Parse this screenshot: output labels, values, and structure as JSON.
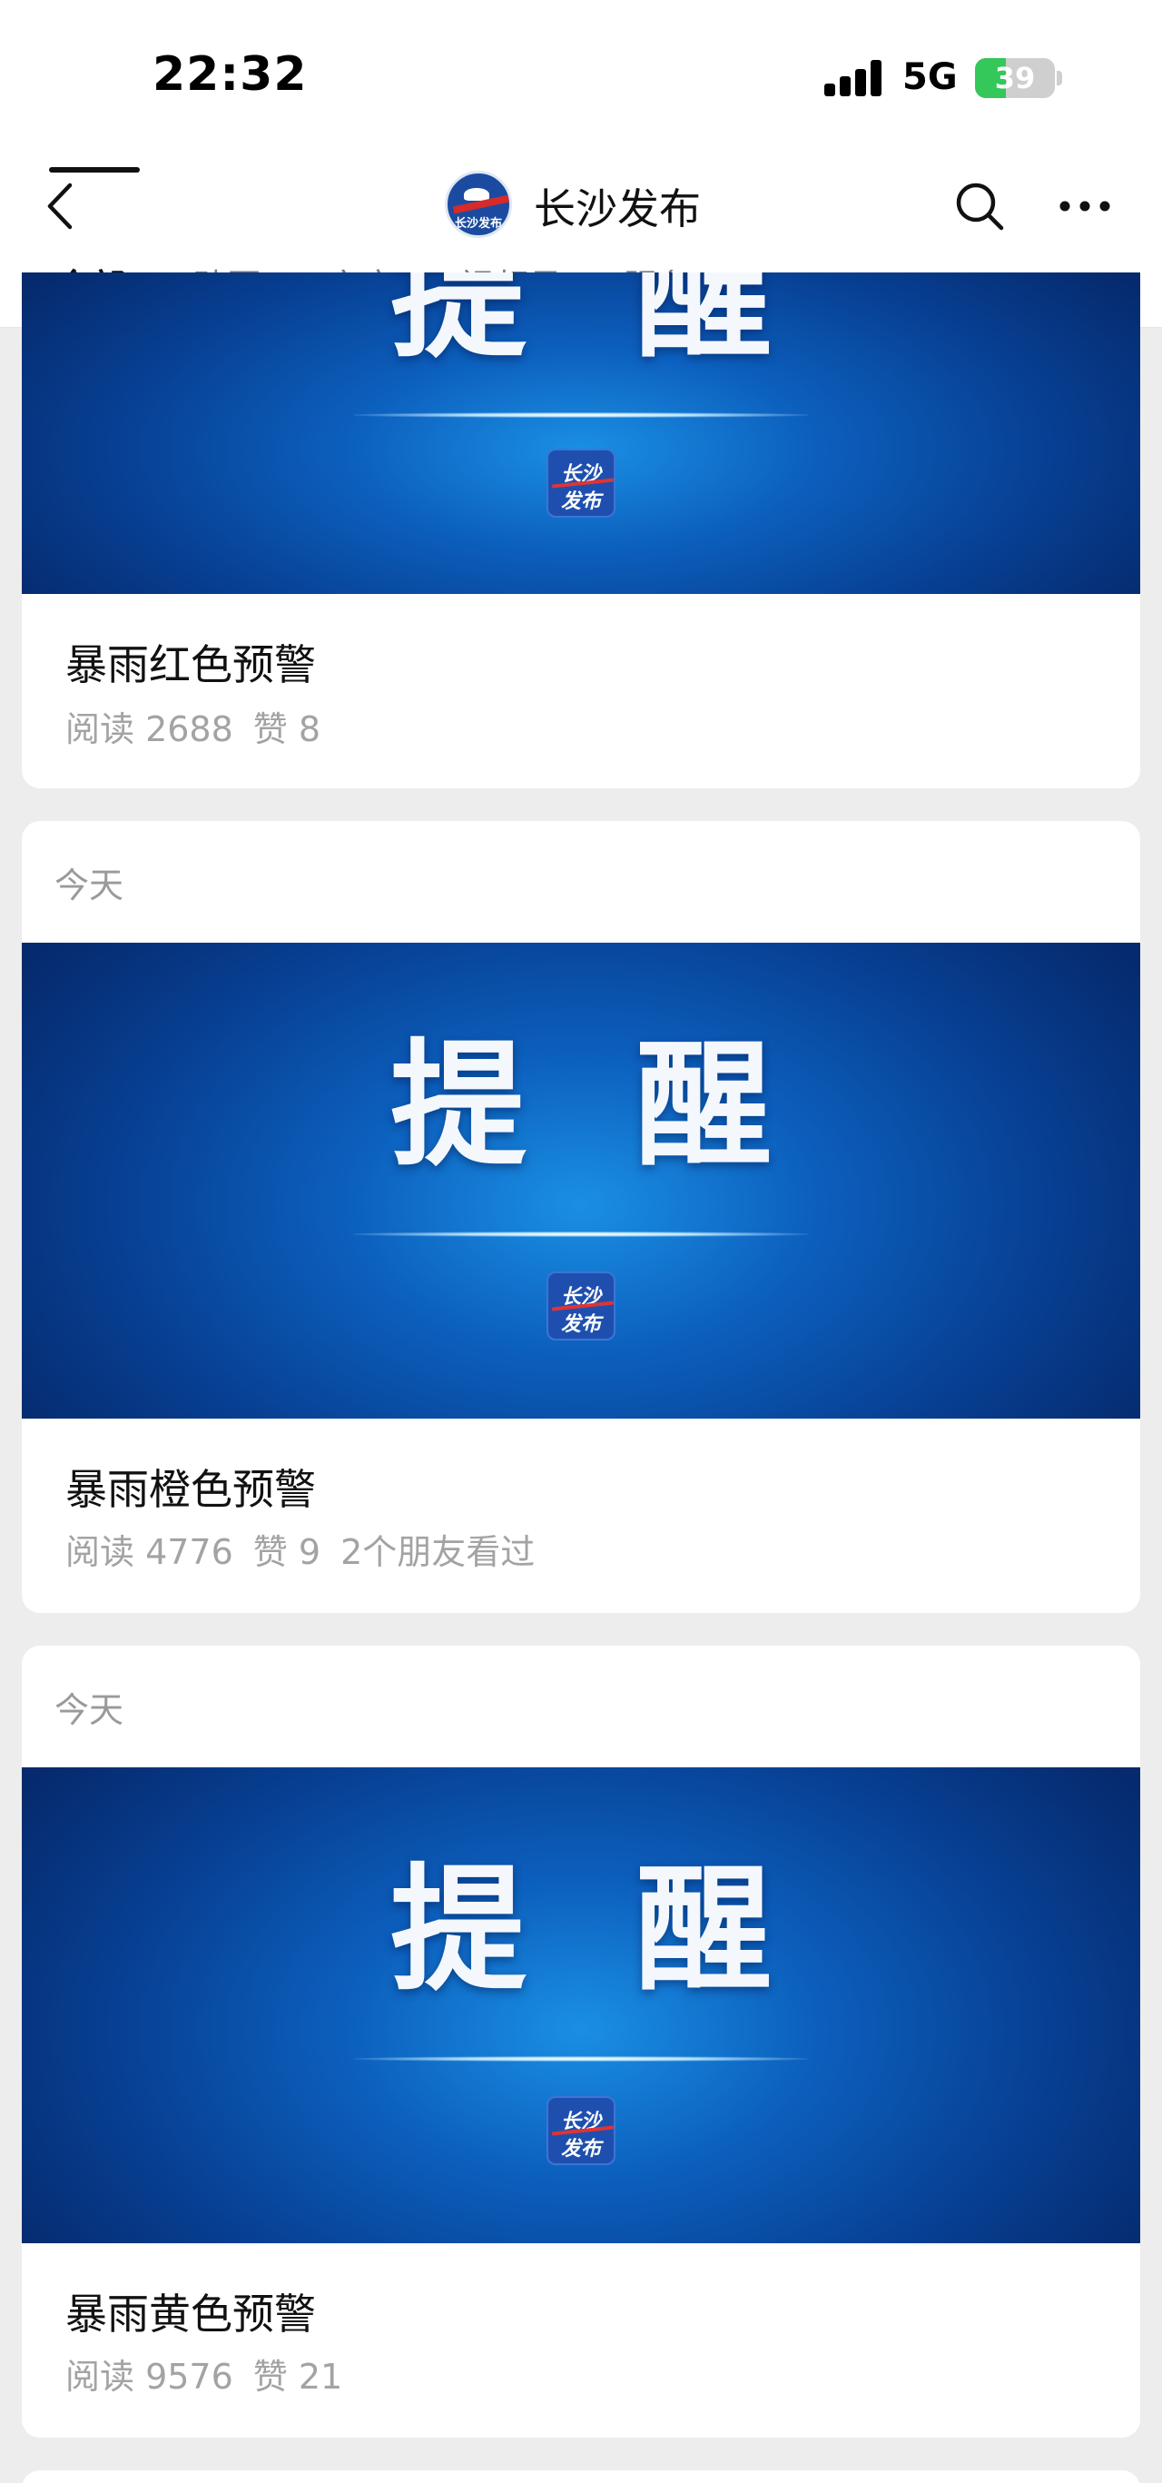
{
  "status_bar": {
    "time": "22:32",
    "network": "5G",
    "battery_level": "39",
    "battery_fraction": 0.39,
    "icons": [
      "signal-icon",
      "battery-charging-icon"
    ]
  },
  "header": {
    "account_name": "长沙发布",
    "logo_text": "长沙发布",
    "icons": [
      "back-chevron-icon",
      "search-icon",
      "more-dots-icon"
    ]
  },
  "tabs": [
    {
      "label": "全部",
      "active": true
    },
    {
      "label": "贴图",
      "active": false
    },
    {
      "label": "文章",
      "active": false
    },
    {
      "label": "视频号",
      "active": false
    },
    {
      "label": "服务",
      "active": false
    }
  ],
  "feed": [
    {
      "date": "",
      "banner_text": "提醒",
      "banner_logo": [
        "长沙",
        "发布"
      ],
      "title": "暴雨红色预警",
      "stats": [
        "阅读 2688",
        "赞 8"
      ]
    },
    {
      "date": "今天",
      "banner_text": "提醒",
      "banner_logo": [
        "长沙",
        "发布"
      ],
      "title": "暴雨橙色预警",
      "stats": [
        "阅读 4776",
        "赞 9",
        "2个朋友看过"
      ]
    },
    {
      "date": "今天",
      "banner_text": "提醒",
      "banner_logo": [
        "长沙",
        "发布"
      ],
      "title": "暴雨黄色预警",
      "stats": [
        "阅读 9576",
        "赞 21"
      ]
    }
  ],
  "colors": {
    "background": "#ededed",
    "banner_dark": "#062a6d",
    "banner_light": "#1a8fe3",
    "battery": "#34c759"
  }
}
